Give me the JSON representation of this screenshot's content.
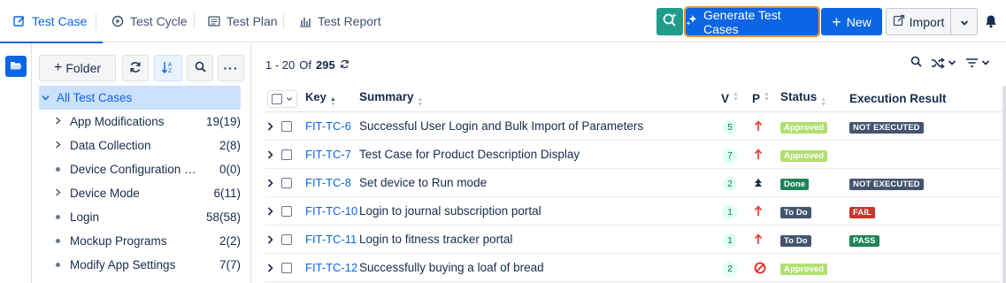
{
  "tabs": [
    {
      "label": "Test Case",
      "icon": "edit-icon",
      "active": true
    },
    {
      "label": "Test Cycle",
      "icon": "cycle-icon"
    },
    {
      "label": "Test Plan",
      "icon": "plan-icon"
    },
    {
      "label": "Test Report",
      "icon": "chart-icon"
    }
  ],
  "toolbar": {
    "generate_label": "Generate Test Cases",
    "new_label": "New",
    "import_label": "Import"
  },
  "folders": {
    "add_label": "Folder",
    "items": [
      {
        "name": "All Test Cases",
        "count": "",
        "selected": true,
        "kind": "root"
      },
      {
        "name": "App Modifications",
        "count": "19(19)",
        "kind": "expand"
      },
      {
        "name": "Data Collection",
        "count": "2(8)",
        "kind": "expand"
      },
      {
        "name": "Device Configuration for…",
        "count": "0(0)",
        "kind": "dot"
      },
      {
        "name": "Device Mode",
        "count": "6(11)",
        "kind": "expand"
      },
      {
        "name": "Login",
        "count": "58(58)",
        "kind": "dot"
      },
      {
        "name": "Mockup Programs",
        "count": "2(2)",
        "kind": "dot"
      },
      {
        "name": "Modify App Settings",
        "count": "7(7)",
        "kind": "dot"
      }
    ]
  },
  "pager": {
    "range": "1 - 20",
    "of": "Of",
    "total": "295"
  },
  "grid": {
    "headers": {
      "key": "Key",
      "summary": "Summary",
      "v": "V",
      "p": "P",
      "status": "Status",
      "exec": "Execution Result"
    },
    "rows": [
      {
        "key": "FIT-TC-6",
        "summary": "Successful User Login and Bulk Import of Parameters",
        "v": "5",
        "priority": "high",
        "status": "Approved",
        "exec": "NOT EXECUTED"
      },
      {
        "key": "FIT-TC-7",
        "summary": "Test Case for Product Description Display",
        "v": "7",
        "priority": "high",
        "status": "Approved",
        "exec": ""
      },
      {
        "key": "FIT-TC-8",
        "summary": "Set device to Run mode",
        "v": "2",
        "priority": "highest",
        "status": "Done",
        "exec": "NOT EXECUTED"
      },
      {
        "key": "FIT-TC-10",
        "summary": "Login to journal subscription portal",
        "v": "1",
        "priority": "high",
        "status": "To Do",
        "exec": "FAIL"
      },
      {
        "key": "FIT-TC-11",
        "summary": "Login to fitness tracker portal",
        "v": "1",
        "priority": "high",
        "status": "To Do",
        "exec": "PASS"
      },
      {
        "key": "FIT-TC-12",
        "summary": "Successfully buying a loaf of bread",
        "v": "2",
        "priority": "blocker",
        "status": "Approved",
        "exec": ""
      }
    ]
  },
  "colors": {
    "accent": "#0c66e4",
    "ai": "#1f9c8a",
    "highlight": "#f5922b"
  }
}
